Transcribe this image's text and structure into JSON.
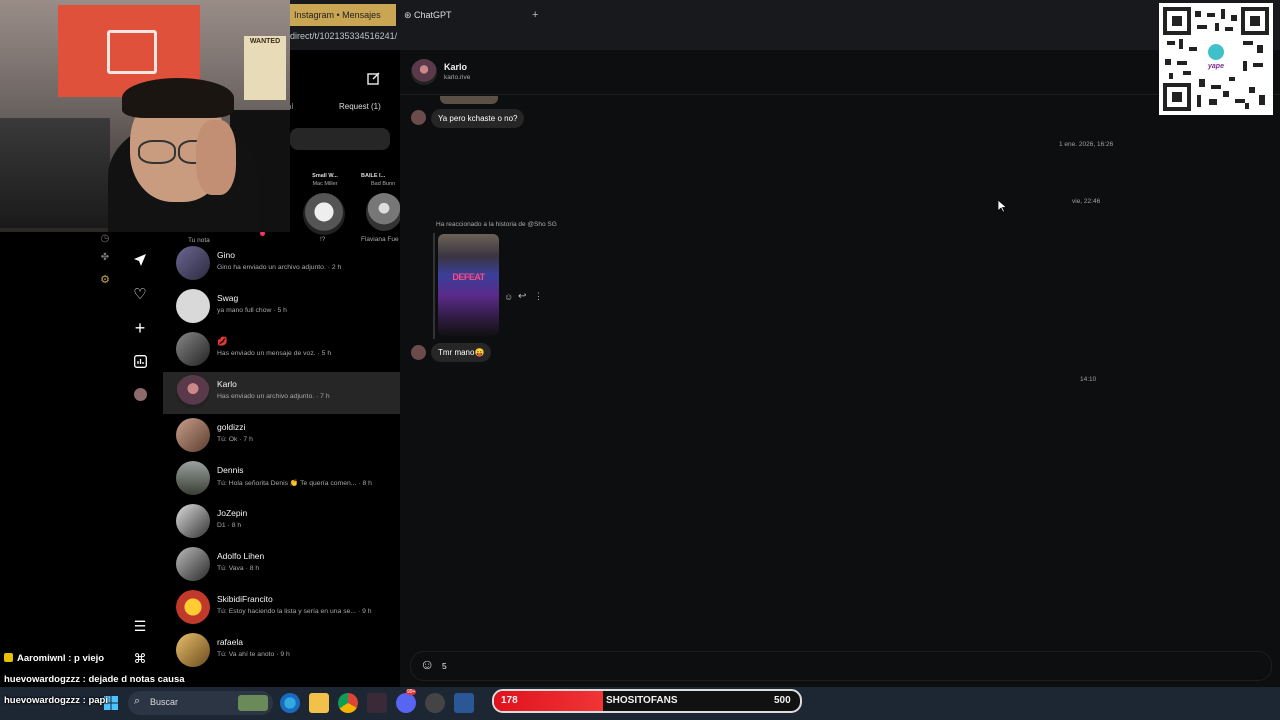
{
  "browser": {
    "tabs": [
      {
        "label": "Instagram • Mensajes"
      },
      {
        "label": "ChatGPT"
      }
    ],
    "new_tab": "+",
    "url": "direct/t/102135334516241/"
  },
  "inbox": {
    "tab_partial": "al",
    "request_label": "Request (1)",
    "notes": [
      {
        "label": "Tu nota"
      },
      {
        "song": "Small W...",
        "artist": "Mac Miller",
        "name": "!?"
      },
      {
        "song": "BAILE I...",
        "artist": "Bad Bunn",
        "name": "Flaviana Fue"
      }
    ],
    "conversations": [
      {
        "name": "Gino",
        "preview": "Gino ha enviado un archivo adjunto. · 2 h"
      },
      {
        "name": "Swag",
        "preview": "ya mano full chow · 5 h"
      },
      {
        "name": "💋",
        "preview": "Has enviado un mensaje de voz. · 5 h"
      },
      {
        "name": "Karlo",
        "preview": "Has enviado un archivo adjunto. · 7 h"
      },
      {
        "name": "goldizzi",
        "preview": "Tú: Ok · 7 h"
      },
      {
        "name": "Dennis",
        "preview": "Tú: Hola señorita Denis 👏 Te quería comen... · 8 h"
      },
      {
        "name": "JoZepin",
        "preview": "D1 · 8 h"
      },
      {
        "name": "Adolfo Lihen",
        "preview": "Tú: Vava · 8 h"
      },
      {
        "name": "SkibidiFrancito",
        "preview": "Tú: Estoy haciendo la lista y sería en una se... · 9 h"
      },
      {
        "name": "rafaela",
        "preview": "Tú: Va ahí te anoto · 9 h"
      }
    ]
  },
  "chat": {
    "contact_name": "Karlo",
    "contact_handle": "karlo.rive",
    "messages": [
      {
        "text": "Ya pero kchaste o no?"
      },
      {
        "text": "Tmr mano😛"
      }
    ],
    "timestamps": [
      "1 ene. 2026, 16:26",
      "vie, 22:46",
      "14:10"
    ],
    "story_reaction": "Ha reaccionado a la historia de @Sho SG",
    "story_text": "DEFEAT",
    "composer_value": "5"
  },
  "webcam": {
    "poster_text": "WANTED"
  },
  "stream_chat": [
    {
      "user": "Aaromiwnl",
      "text": " : p viejo"
    },
    {
      "user": "huevowardogzzz",
      "text": " : dejade d notas causa"
    },
    {
      "user": "huevowardogzzz",
      "text": " : papi"
    }
  ],
  "taskbar": {
    "search_label": "Buscar",
    "badge": "99+",
    "goal_left": "178",
    "goal_name": "SHOSITOFANS",
    "goal_right": "500",
    "goal_progress": 0.356
  },
  "qr": {
    "brand": "yape"
  },
  "colors": {
    "accent_tab": "#c9a554",
    "goal_red": "#e0121d",
    "chat_bg": "#0d0e10"
  }
}
